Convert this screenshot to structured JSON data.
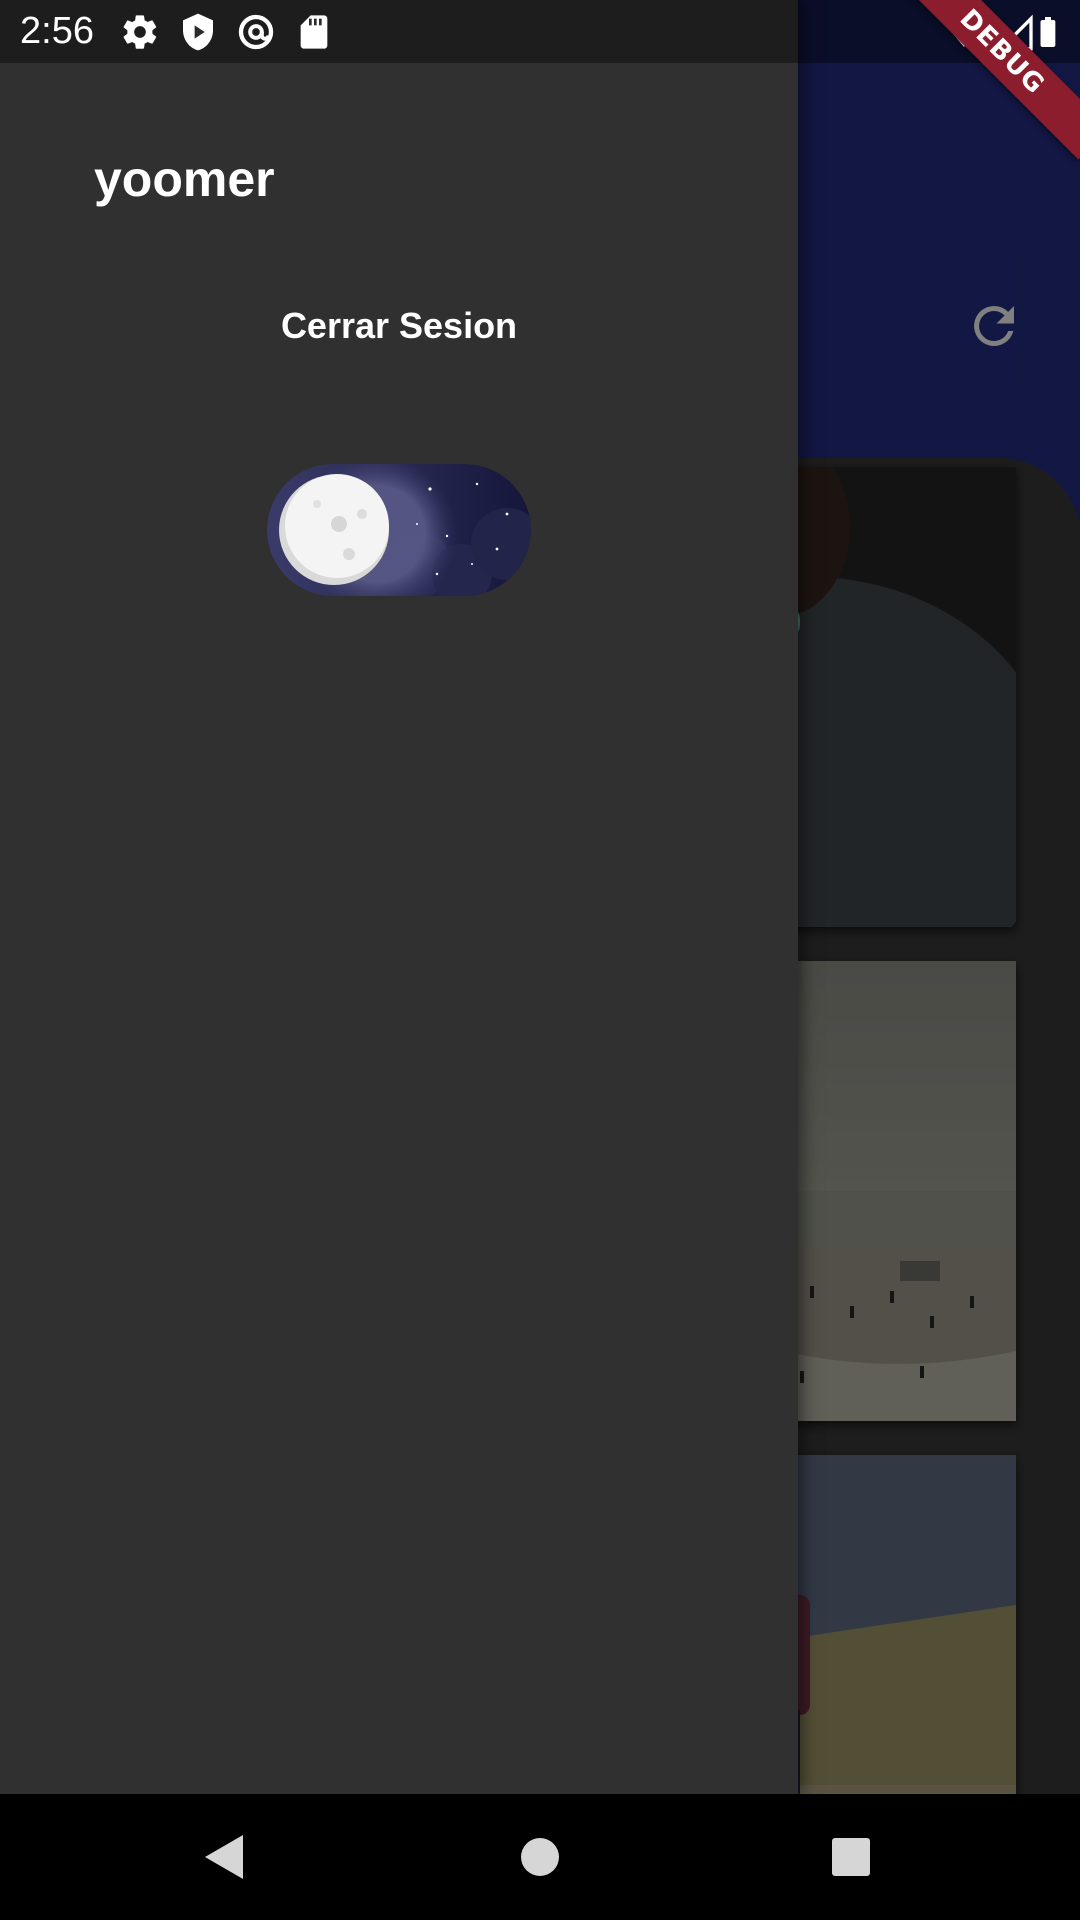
{
  "status_bar": {
    "time": "2:56",
    "left_icons": [
      "settings-icon",
      "shield-play-icon",
      "at-sync-icon",
      "sd-card-icon"
    ],
    "right_icons": [
      "wifi-icon",
      "cellular-signal-icon",
      "battery-icon"
    ]
  },
  "debug_banner": {
    "label": "DEBUG",
    "color": "#8b1d2c"
  },
  "drawer": {
    "username": "yoomer",
    "logout_label": "Cerrar Sesion",
    "theme_toggle": {
      "state": "dark",
      "icon": "moon-icon"
    },
    "background": "#303030"
  },
  "background_app": {
    "header_color": "#1c2363",
    "refresh_icon": "refresh-icon",
    "cards": [
      {
        "subject": "person-with-mug"
      },
      {
        "subject": "beach-crowd"
      },
      {
        "subject": "father-and-child-on-dunes"
      }
    ]
  },
  "nav_bar": {
    "buttons": [
      "back-icon",
      "home-icon",
      "recents-icon"
    ]
  }
}
